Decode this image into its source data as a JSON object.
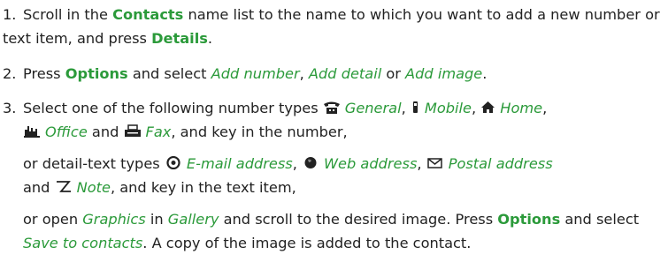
{
  "steps": [
    {
      "number": "1.",
      "t1": "Scroll in the ",
      "contacts": "Contacts",
      "t2": " name list to the name to which you want to add a new number or text item, and press ",
      "details": "Details",
      "t3": "."
    },
    {
      "number": "2.",
      "t1": "Press ",
      "options": "Options",
      "t2": " and select ",
      "add_number": "Add number",
      "sep1": ", ",
      "add_detail": "Add detail",
      "t3": " or ",
      "add_image": "Add image",
      "t4": "."
    },
    {
      "number": "3.",
      "t1": "Select one of the following number types ",
      "general": "General",
      "sep1": ",  ",
      "mobile": "Mobile",
      "sep2": ", ",
      "home": "Home",
      "sep3": ",",
      "office": "Office",
      "t2": " and ",
      "fax": "Fax",
      "t3": ", and key in the number,",
      "p2_t1": "or detail-text types ",
      "email": "E-mail address",
      "sep4": ",  ",
      "web": "Web address",
      "sep5": ",  ",
      "postal": "Postal address",
      "p2_t2": " and ",
      "note": "Note",
      "p2_t3": ", and key in the text item,",
      "p3_t1": "or open ",
      "graphics": "Graphics",
      "p3_t2": " in ",
      "gallery": "Gallery",
      "p3_t3": " and scroll to the desired image. Press ",
      "options": "Options",
      "p3_t4": " and select ",
      "save": "Save to contacts",
      "p3_t5": ". A copy of the image is added to the contact."
    }
  ],
  "icons": [
    "general-phone-icon",
    "mobile-phone-icon",
    "home-icon",
    "office-icon",
    "fax-icon",
    "email-icon",
    "web-icon",
    "postal-icon",
    "note-icon"
  ],
  "accent_color": "#2b9a3a"
}
